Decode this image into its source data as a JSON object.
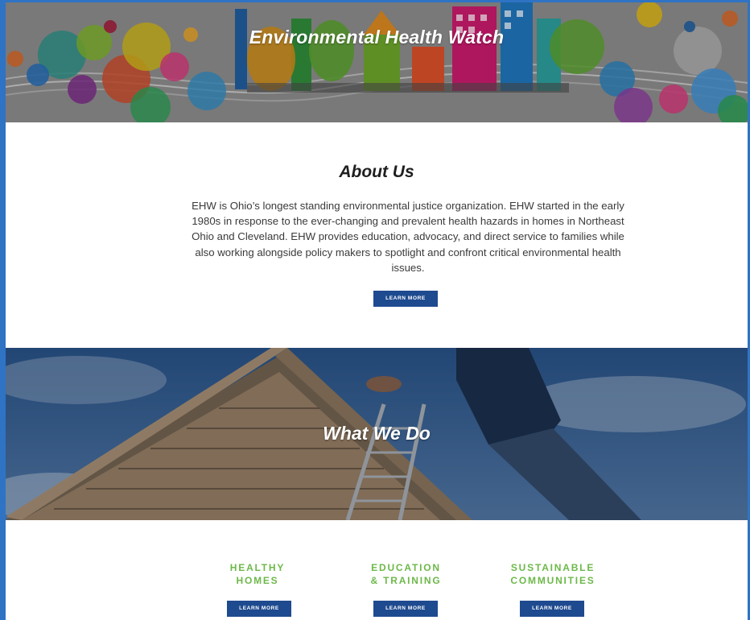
{
  "header": {
    "title": "Environmental Health Watch"
  },
  "about": {
    "heading": "About Us",
    "body": "EHW is Ohio’s longest standing environmental justice organization. EHW started in the early 1980s in response to the ever-changing and prevalent health hazards in homes in Northeast Ohio and Cleveland. EHW provides education, advocacy, and direct service to families while also working alongside policy makers to spotlight and confront critical environmental health issues.",
    "button_label": "LEARN MORE"
  },
  "what_we_do": {
    "heading": "What We Do"
  },
  "services": [
    {
      "line1": "HEALTHY",
      "line2": "HOMES",
      "button_label": "LEARN MORE"
    },
    {
      "line1": "EDUCATION",
      "line2": "& TRAINING",
      "button_label": "LEARN MORE"
    },
    {
      "line1": "SUSTAINABLE",
      "line2": "COMMUNITIES",
      "button_label": "LEARN MORE"
    }
  ],
  "colors": {
    "accent_green": "#6db84a",
    "button_blue": "#1e4a8f",
    "frame_blue": "#2f73c4"
  }
}
